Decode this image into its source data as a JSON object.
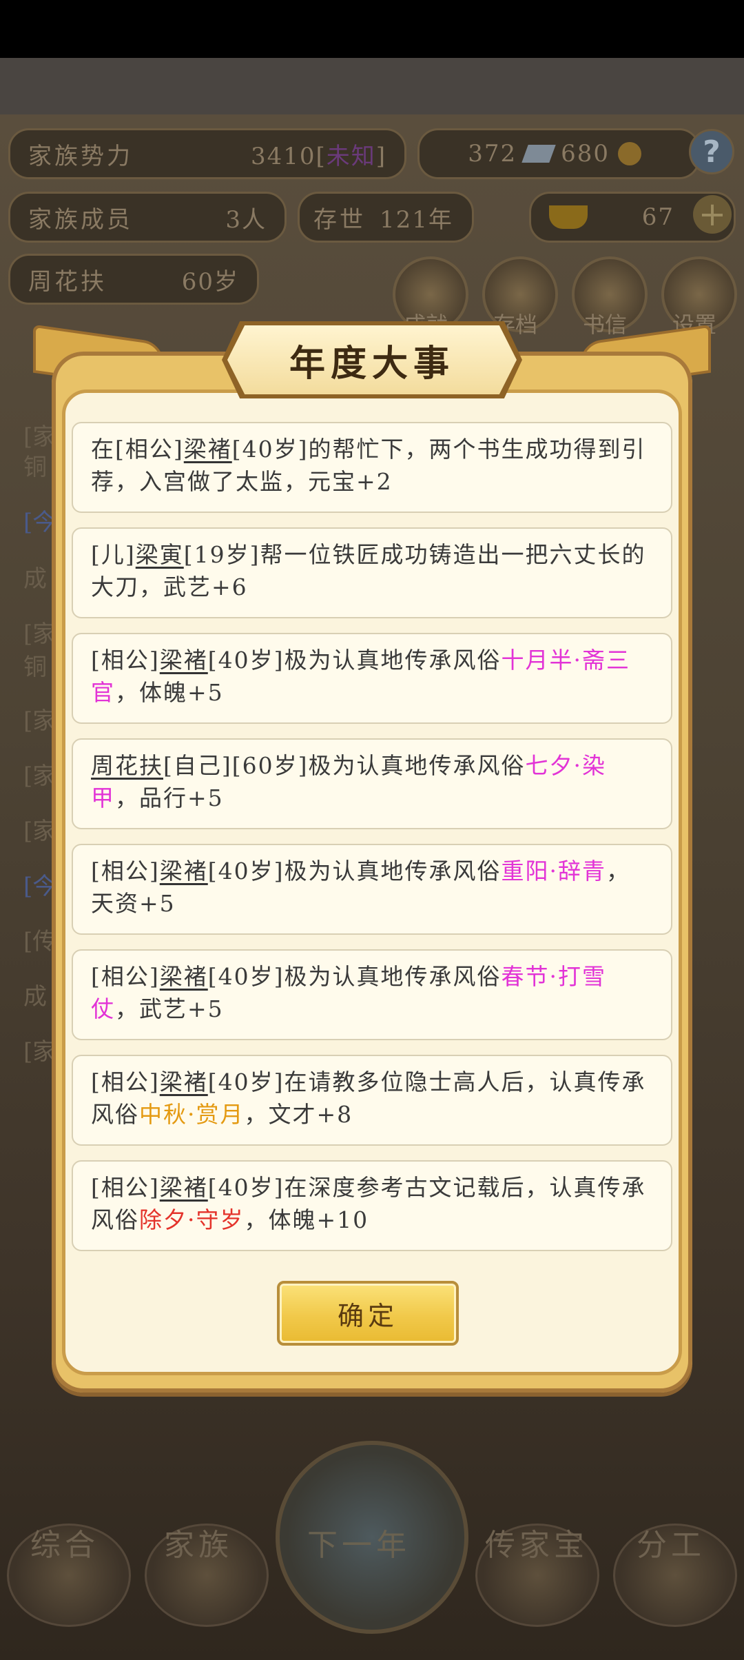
{
  "hud": {
    "family_power_label": "家族势力",
    "family_power_value": "3410[",
    "family_power_rank": "未知",
    "family_power_close": "]",
    "silver": "372",
    "copper": "680",
    "help": "?",
    "members_label": "家族成员",
    "members_value": "3人",
    "age_label": "存世",
    "age_value": "121年",
    "gold": "67",
    "player_name": "周花扶",
    "player_age": "60岁"
  },
  "top_menu": [
    {
      "label": "成就"
    },
    {
      "label": "存档"
    },
    {
      "label": "书信"
    },
    {
      "label": "设置"
    }
  ],
  "bottom_nav": [
    {
      "label": "综合"
    },
    {
      "label": "家族"
    },
    {
      "label": "下一年"
    },
    {
      "label": "传家宝"
    },
    {
      "label": "分工"
    }
  ],
  "dialog": {
    "title": "年度大事",
    "confirm_label": "确定",
    "events": [
      {
        "p1": "在[相公]",
        "name": "梁褚",
        "p2": "[40岁]的帮忙下，两个书生成功得到引荐，入宫做了太监，元宝+2",
        "hl": "",
        "p3": ""
      },
      {
        "p1": "[儿]",
        "name": "梁寅",
        "p2": "[19岁]帮一位铁匠成功铸造出一把六丈长的大刀，武艺+6",
        "hl": "",
        "p3": ""
      },
      {
        "p1": "[相公]",
        "name": "梁褚",
        "p2": "[40岁]极为认真地传承风俗",
        "hl": "十月半·斋三官",
        "p3": "，体魄+5"
      },
      {
        "p1": "",
        "name": "周花扶",
        "p2": "[自己][60岁]极为认真地传承风俗",
        "hl": "七夕·染甲",
        "p3": "，品行+5"
      },
      {
        "p1": "[相公]",
        "name": "梁褚",
        "p2": "[40岁]极为认真地传承风俗",
        "hl": "重阳·辞青",
        "p3": "，天资+5"
      },
      {
        "p1": "[相公]",
        "name": "梁褚",
        "p2": "[40岁]极为认真地传承风俗",
        "hl": "春节·打雪仗",
        "p3": "，武艺+5"
      },
      {
        "p1": "[相公]",
        "name": "梁褚",
        "p2": "[40岁]在请教多位隐士高人后，认真传承风俗",
        "hl": "中秋·赏月",
        "p3": "，文才+8"
      },
      {
        "p1": "[相公]",
        "name": "梁褚",
        "p2": "[40岁]在深度参考古文记载后，认真传承风俗",
        "hl": "除夕·守岁",
        "p3": "，体魄+10"
      }
    ],
    "highlight_colors": [
      "#e233d6",
      "#e233d6",
      "#e233d6",
      "#e233d6",
      "#e49a12",
      "#e4332b"
    ]
  },
  "side_text": [
    "[家",
    "铜",
    "[今",
    "成",
    "[家",
    "铜",
    "[家",
    "[家",
    "[家",
    "[今",
    "[传",
    "成",
    "[家"
  ]
}
